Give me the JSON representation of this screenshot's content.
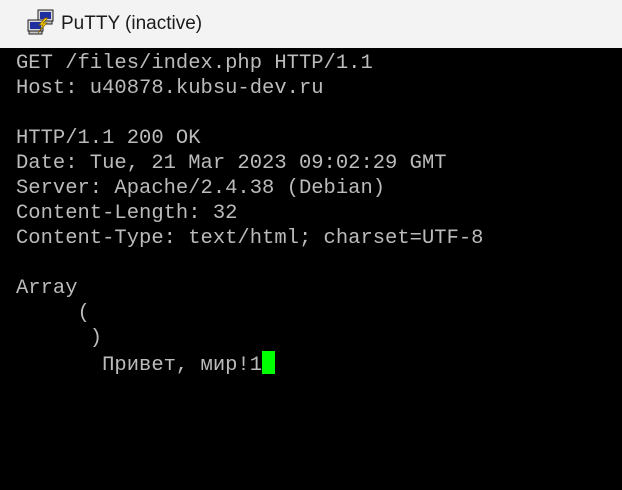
{
  "window": {
    "title": "PuTTY (inactive)",
    "icon": "putty-icon"
  },
  "colors": {
    "terminal_background": "#000000",
    "terminal_text": "#bbbbbb",
    "cursor": "#00ff00",
    "titlebar": "#f3f3f3"
  },
  "terminal": {
    "lines": [
      "GET /files/index.php HTTP/1.1",
      "Host: u40878.kubsu-dev.ru",
      "",
      "HTTP/1.1 200 OK",
      "Date: Tue, 21 Mar 2023 09:02:29 GMT",
      "Server: Apache/2.4.38 (Debian)",
      "Content-Length: 32",
      "Content-Type: text/html; charset=UTF-8",
      "",
      "Array",
      "     (",
      "      )",
      "       Привет, мир!1"
    ]
  }
}
